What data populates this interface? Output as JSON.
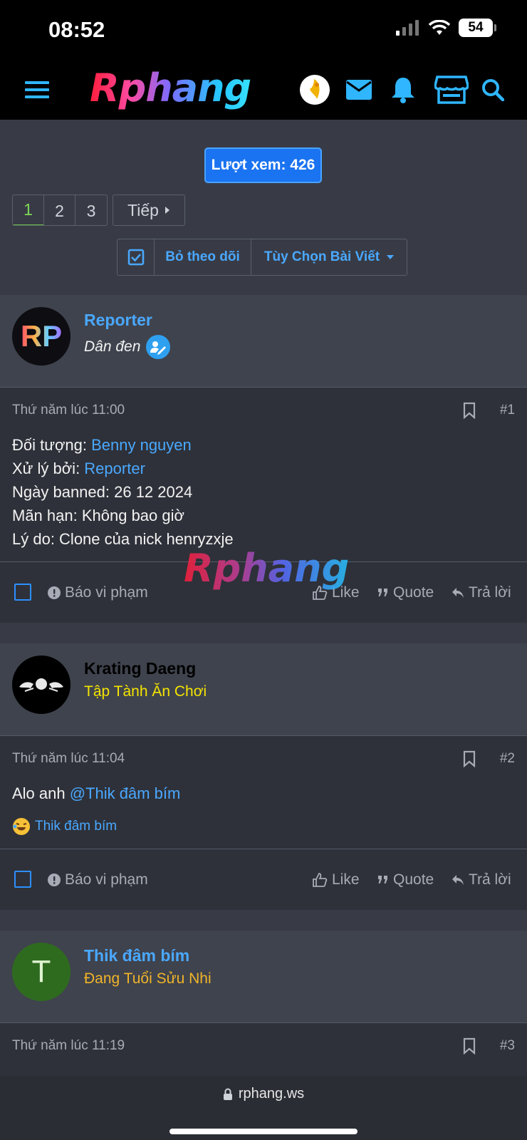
{
  "status": {
    "time": "08:52",
    "battery": "54"
  },
  "nav": {
    "logo": "Rphang"
  },
  "thread": {
    "view_count": "Lượt xem: 426",
    "pages": [
      "1",
      "2",
      "3"
    ],
    "next_label": "Tiếp",
    "unfollow_label": "Bỏ theo dõi",
    "options_label": "Tùy Chọn Bài Viết"
  },
  "posts": [
    {
      "avatar_text": "RP",
      "username": "Reporter",
      "user_title": "Dân đen",
      "time": "Thứ năm lúc 11:00",
      "number": "#1",
      "lines": [
        {
          "label": "Đối tượng: ",
          "value": "Benny nguyen"
        },
        {
          "label": "Xử lý bởi: ",
          "value": "Reporter"
        },
        {
          "label": "Ngày banned: 26 12 2024"
        },
        {
          "label": "Mãn hạn: Không bao giờ"
        },
        {
          "label": "Lý do: Clone của nick henryzxje"
        }
      ]
    },
    {
      "username": "Krating Daeng",
      "user_title": "Tập Tành Ăn Chơi",
      "time": "Thứ năm lúc 11:04",
      "number": "#2",
      "text": "Alo anh ",
      "mention": "@Thik đâm bím",
      "reaction_user": "Thik đâm bím"
    },
    {
      "avatar_text": "T",
      "username": "Thik đâm bím",
      "user_title": "Đang Tuổi Sửu Nhi",
      "time": "Thứ năm lúc 11:19",
      "number": "#3"
    }
  ],
  "actions": {
    "report": "Báo vi phạm",
    "like": "Like",
    "quote": "Quote",
    "reply": "Trả lời"
  },
  "watermark": "Rphang",
  "browser": {
    "url": "rphang.ws"
  },
  "colors": {
    "accent": "#4aa8ff",
    "title_yellow": "#f5e400",
    "title_orange": "#f0b429",
    "page_bg": "#383b45"
  }
}
